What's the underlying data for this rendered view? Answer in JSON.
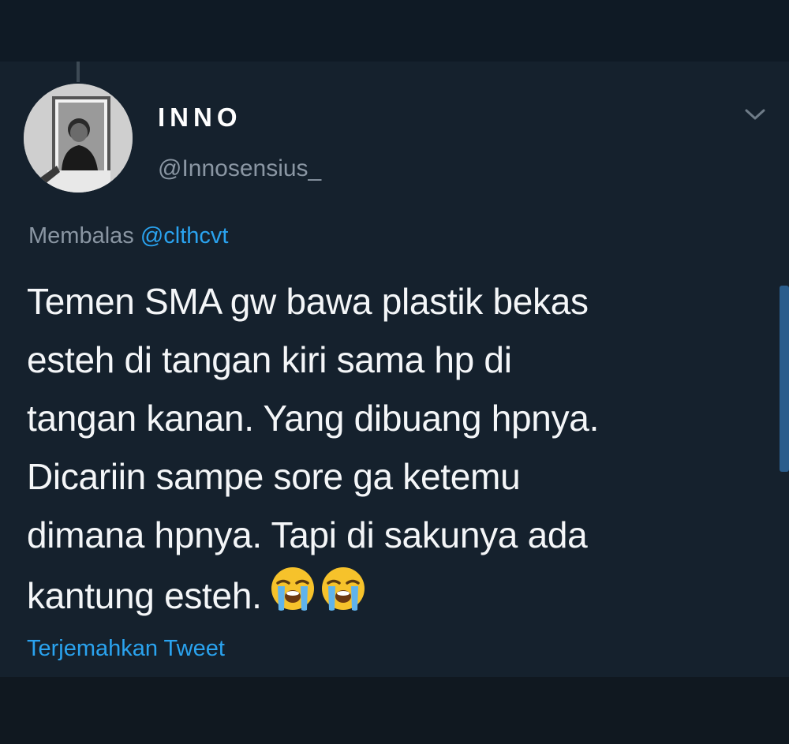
{
  "tweet": {
    "display_name": "INNO",
    "handle": "@Innosensius_",
    "reply_prefix": "Membalas",
    "reply_to": "@clthcvt",
    "text_lines": [
      "Temen SMA gw bawa plastik bekas",
      "esteh di tangan kiri sama hp di",
      "tangan kanan. Yang dibuang hpnya.",
      "Dicariin sampe sore ga ketemu",
      "dimana hpnya. Tapi di sakunya ada",
      "kantung esteh."
    ],
    "emojis": [
      "loudly-crying-face",
      "loudly-crying-face"
    ],
    "translate_label": "Terjemahkan Tweet"
  },
  "colors": {
    "background": "#101820",
    "card": "#15212d",
    "text": "#f4f6f8",
    "muted": "#8a96a3",
    "accent": "#2aa3ef"
  },
  "icons": {
    "menu": "chevron-down-icon",
    "emoji": "loudly-crying-face-icon"
  }
}
